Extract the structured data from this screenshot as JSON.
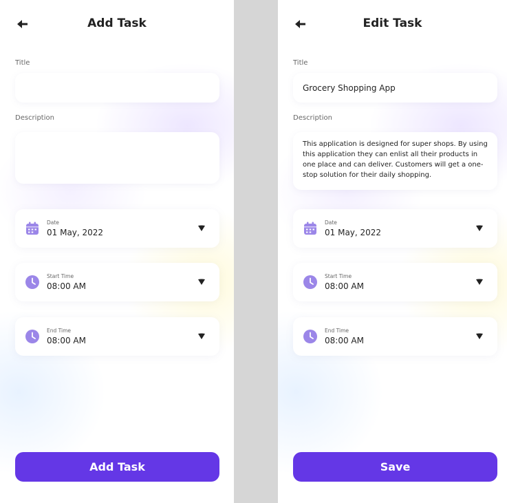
{
  "add_screen": {
    "header_title": "Add Task",
    "title_label": "Title",
    "title_value": "",
    "description_label": "Description",
    "description_value": "",
    "date_label": "Date",
    "date_value": "01 May, 2022",
    "start_time_label": "Start Time",
    "start_time_value": "08:00 AM",
    "end_time_label": "End Time",
    "end_time_value": "08:00 AM",
    "button_label": "Add Task"
  },
  "edit_screen": {
    "header_title": "Edit Task",
    "title_label": "Title",
    "title_value": "Grocery Shopping App",
    "description_label": "Description",
    "description_value": "This application is designed for super shops. By using this application they can enlist all their products in one place and can deliver. Customers will get a one-stop solution for their daily shopping.",
    "date_label": "Date",
    "date_value": "01 May, 2022",
    "start_time_label": "Start Time",
    "start_time_value": "08:00 AM",
    "end_time_label": "End Time",
    "end_time_value": "08:00 AM",
    "button_label": "Save"
  },
  "icons": {
    "back": "back-arrow-icon",
    "date": "calendar-icon",
    "time": "clock-icon",
    "dropdown": "caret-down-icon"
  },
  "colors": {
    "accent": "#6437e6",
    "icon_purple": "#9b86e8",
    "separator": "#d6d6d6",
    "text_primary": "#222222",
    "text_secondary": "#666666"
  }
}
